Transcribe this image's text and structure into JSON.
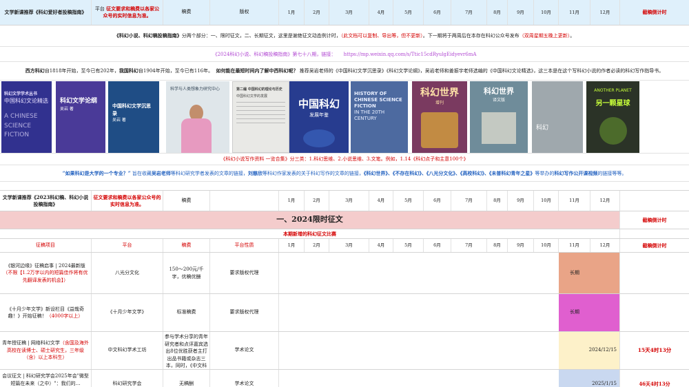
{
  "months": [
    "1月",
    "2月",
    "3月",
    "4月",
    "5月",
    "6月",
    "7月",
    "8月",
    "9月",
    "10月",
    "11月",
    "12月"
  ],
  "header1": {
    "title": "文学新课推荐《科幻爱好者投稿指南》",
    "platform_pre": "平台",
    "platform_red": "征文要求和稿费以各家公众号的实时信息为准。",
    "fee": "稿费",
    "rights": "版权",
    "countdown": "截稿倒计时"
  },
  "intro": {
    "t1": "《科幻小说、科幻稿投稿指南》",
    "t2": "分两个部分：一、限时征文，二、长期征文，这里是谢绝征文动态例计时，",
    "t3": "（此文档可以复制、导出等，但不更新）",
    "t4": "。下一期将于两周后在本存在科幻公众号发布",
    "t5": "（双周星期五晚上更新）",
    "t6": "。"
  },
  "issue": {
    "text": "《2024科幻小说、科幻稿投稿指南》第七十八期，链接：",
    "link": "https://mp.weixin.qq.com/s/Ttic15cdRyulgEidyevr6mA"
  },
  "china": {
    "p1": "西方科幻",
    "p2": "自1818年开始，至今已有202年，",
    "p3": "我国科幻",
    "p4": "自1904年开始，至今已有116年。",
    "p5": "如何能在最短时间内了解中西科幻呢？",
    "p6": "推荐吴岩老师的《中国科幻文学沉思录》《科幻文学论纲》，吴岩老师和姜振宇老师选编的《中国科幻文论精选》，这三本是在这个写科幻小说的作者必读的科幻写作指导书。"
  },
  "covers": [
    {
      "label": "科幻文学学术丛书",
      "label2": "中国科幻文论精选",
      "bg": "#31318f",
      "fg": "#e8e0ff"
    },
    {
      "label": "科幻文学论纲",
      "label2": "吴岩 著",
      "bg": "#4a3a98",
      "fg": "#ffffff"
    },
    {
      "label": "中国科幻文学沉思录",
      "label2": "吴岩 著",
      "bg": "#1f4d85",
      "fg": "#ffffff"
    },
    {
      "label": "科学与人类想象力研究中心",
      "label2": "",
      "bg": "#dfe6ea",
      "fg": "#3a4c5c"
    },
    {
      "label": "第二编 中国科幻的理论与历史",
      "label2": "中国科幻文学的发展",
      "bg": "#e9e9e6",
      "fg": "#444444"
    },
    {
      "label": "中国科幻",
      "label2": "发展年鉴",
      "bg": "#273c8f",
      "fg": "#ffffff"
    },
    {
      "label": "HISTORY OF CHINESE SCIENCE FICTION",
      "label2": "IN THE 20TH CENTURY",
      "bg": "#4d6aa0",
      "fg": "#e8eeff"
    },
    {
      "label": "科幻世界",
      "label2": "增刊",
      "bg": "#7a3a60",
      "fg": "#ffe3a8"
    },
    {
      "label": "科幻世界",
      "label2": "译文版",
      "bg": "#6f8c9a",
      "fg": "#ffffff"
    },
    {
      "label": "科幻",
      "label2": "",
      "bg": "#9fa8ad",
      "fg": "#ffffff"
    },
    {
      "label": "ANOTHER PLANET",
      "label2": "另一颗星球",
      "bg": "#2b3327",
      "fg": "#c7ff3a"
    }
  ],
  "tags": {
    "t1": "《科幻小说写作资料 一览合集》",
    "t2": "分三类：1.科幻思维、2.小说思维、3.文笔。例如，1.14《科幻点子和主意100个》"
  },
  "notfriend": {
    "q": "“如果科幻是大学的一个专业？”",
    "a1": "旨在收藏",
    "a2": "吴岩老师",
    "a3": "等科幻研究学者发表的文章的链接，",
    "a4": "刘慈欣",
    "a5": "等科幻作家发表的关于科幻写作的文章的链接，",
    "a6": "《科幻世界》、《不存在科幻》、《八光分文化》、《高校科幻》、《未普科幻青年之星》",
    "a7": "等举办的",
    "a8": "科幻写作公开课视频",
    "a9": "的链接等等。"
  },
  "header2": {
    "title": "文学新课推荐《2023科幻稿、科幻小说投稿指南》",
    "platform": "征文要求和稿费以各家公众号的实时信息为准。",
    "fee": "稿费"
  },
  "section": {
    "title": "一、2024限时征文",
    "countdown": "截稿倒计时",
    "subtitle": "本期新增的科幻征文比赛"
  },
  "colheads": {
    "item": "征稿项目",
    "platform": "平台",
    "fee": "稿费",
    "nature": "平台性质",
    "countdown": "截稿倒计时"
  },
  "rows": [
    {
      "item_black": "《银河边缘》征稿启事 | 2024最新版",
      "item_red": "（不限【1.2万字以内的短篇佳作将有优先翻译发表的机会】）",
      "platform": "八光分文化",
      "fee": "150～200元/千字，优稿优酬",
      "nature": "要求版权代理",
      "bar": "长期",
      "countdown": ""
    },
    {
      "item_black": "《十月少年文学》新设栏目《益哉奇趣！》开始征稿！",
      "item_red": "（4000字以上）",
      "platform": "《十月少年文学》",
      "fee": "标准稿费",
      "nature": "要求版权代理",
      "bar": "长期",
      "countdown": ""
    },
    {
      "item_black": "青年授征稿 | 网络科幻文学",
      "item_red": "（含国及海外高校在读博士、硕士研究生，三年级（含）以上本科生）",
      "platform": "中文科幻学术工坊",
      "fee": "参与学术分享的青年研究者和点评嘉宾选出8位优胜获者主打出品书籍或杂志三本，同时，《中文科幻学术辑刊》",
      "nature": "学术论文",
      "bar": "2024/12/15",
      "countdown": "15天4时13分"
    },
    {
      "item_black": "会议征文 | 科幻研究学会2025年会\"微型短篇在未来（之中）\"：我们的…",
      "item_red": "",
      "platform": "科幻研究学会",
      "fee": "无稿酬",
      "nature": "学术论文",
      "bar": "2025/1/15",
      "countdown": "46天4时13分"
    }
  ]
}
